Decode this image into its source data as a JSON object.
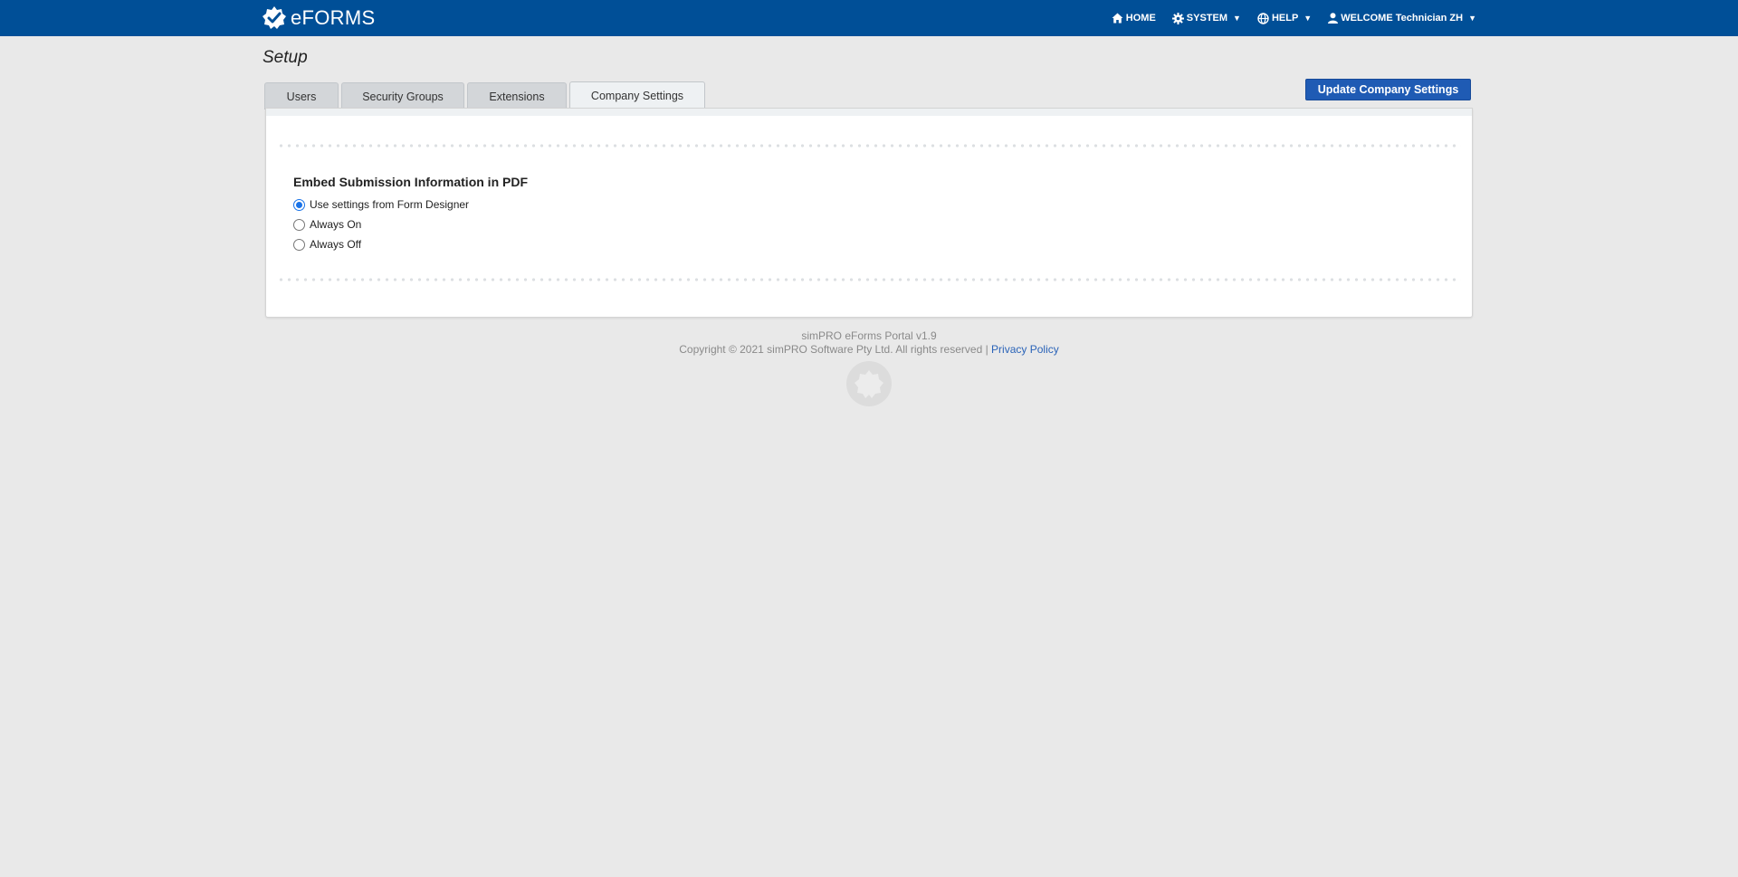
{
  "brand": {
    "name": "eFORMS"
  },
  "nav": {
    "home": "HOME",
    "system": "SYSTEM",
    "help": "HELP",
    "welcome": "WELCOME Technician ZH",
    "caret": "▼"
  },
  "page": {
    "title": "Setup"
  },
  "tabs": [
    {
      "label": "Users"
    },
    {
      "label": "Security Groups"
    },
    {
      "label": "Extensions"
    },
    {
      "label": "Company Settings",
      "active": true
    }
  ],
  "actions": {
    "update_label": "Update Company Settings"
  },
  "settings": {
    "heading": "Embed Submission Information in PDF",
    "options": [
      {
        "label": "Use settings from Form Designer",
        "checked": true
      },
      {
        "label": "Always On",
        "checked": false
      },
      {
        "label": "Always Off",
        "checked": false
      }
    ]
  },
  "footer": {
    "version": "simPRO eForms Portal v1.9",
    "copyright": "Copyright © 2021 simPRO Software Pty Ltd. All rights reserved |",
    "privacy": "Privacy Policy"
  },
  "colors": {
    "topbar": "#004f97",
    "button": "#1f5bb4",
    "link": "#2a63b8",
    "radio_checked": "#1a73e8"
  }
}
